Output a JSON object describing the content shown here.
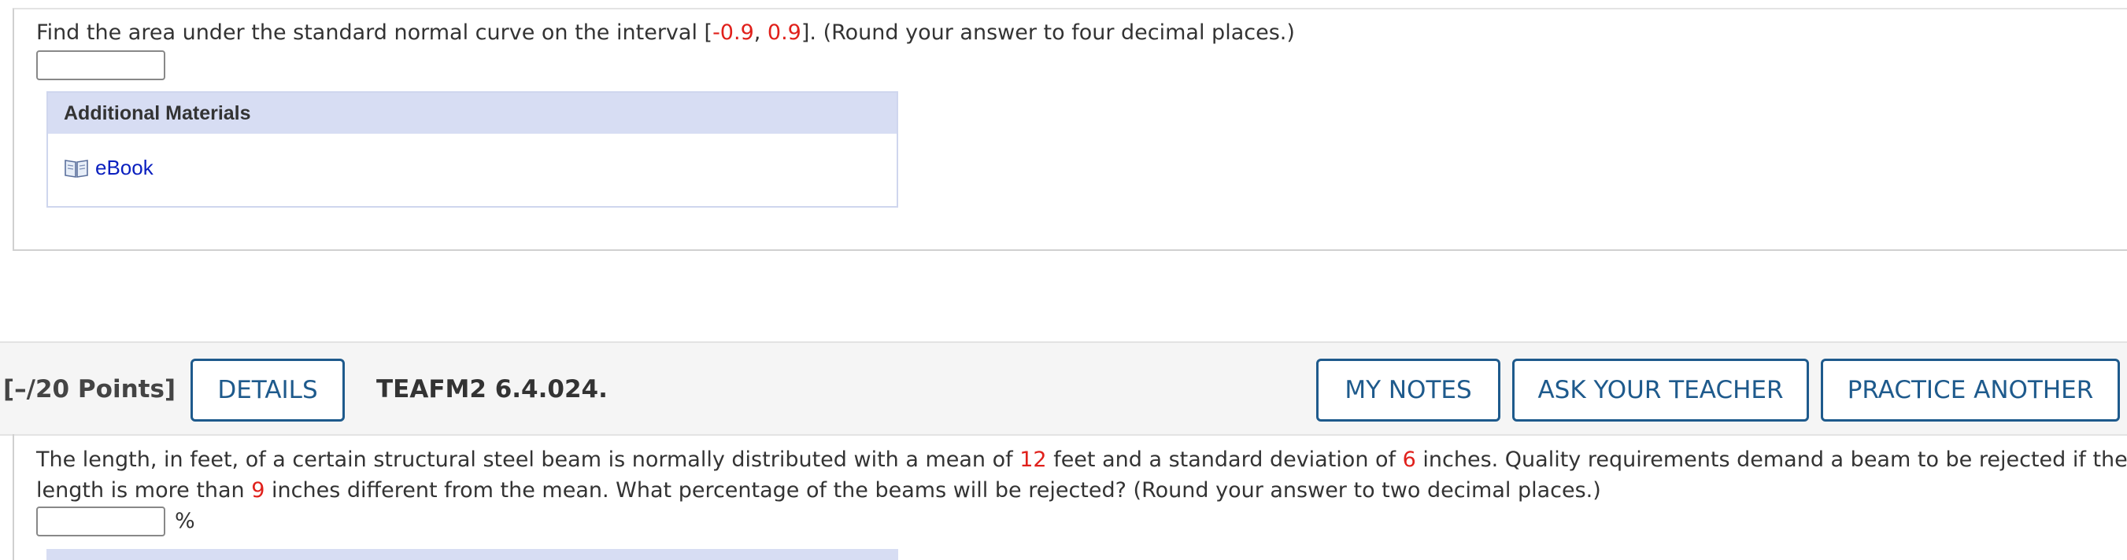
{
  "question1": {
    "text_before": "Find the area under the standard normal curve on the interval [",
    "val_a": "-0.9",
    "sep": ", ",
    "val_b": "0.9",
    "text_after": "]. (Round your answer to four decimal places.)",
    "answer_value": ""
  },
  "additional_materials": {
    "title": "Additional Materials",
    "ebook_label": "eBook",
    "ebook_icon": "book-icon"
  },
  "question2_header": {
    "points": "[–/20 Points]",
    "details_label": "DETAILS",
    "code": "TEAFM2 6.4.024.",
    "my_notes_label": "MY NOTES",
    "ask_teacher_label": "ASK YOUR TEACHER",
    "practice_another_label": "PRACTICE ANOTHER"
  },
  "question2": {
    "l1_a": "The length, in feet, of a certain structural steel beam is normally distributed with a mean of ",
    "mean": "12",
    "l1_b": " feet and a standard deviation of ",
    "sd": "6",
    "l1_c": " inches. Quality requirements demand a beam to be rejected if the",
    "l2_a": "length is more than ",
    "diff": "9",
    "l2_b": " inches different from the mean. What percentage of the beams will be rejected? (Round your answer to two decimal places.)",
    "unit": "%",
    "answer_value": ""
  },
  "colors": {
    "accent": "#1e5a8c",
    "variable_red": "#e0201b",
    "link_blue": "#0a1fbf",
    "materials_header_bg": "#d7ddf3"
  }
}
